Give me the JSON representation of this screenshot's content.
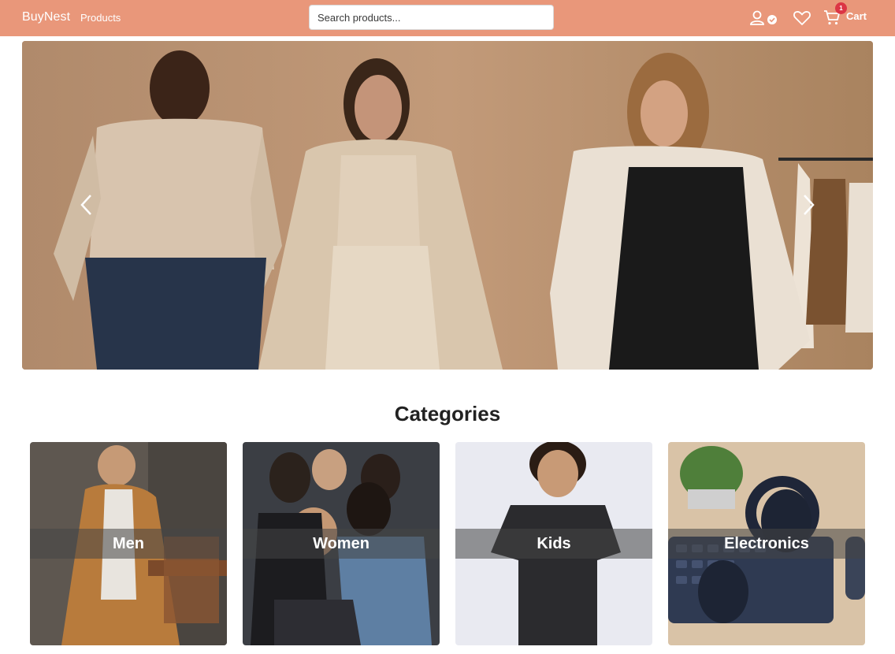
{
  "navbar": {
    "brand": "BuyNest",
    "products_link": "Products",
    "search_placeholder": "Search products...",
    "cart_label": "Cart",
    "cart_count": "1",
    "bg_color": "#E9977A",
    "icons": [
      "user-check-icon",
      "heart-icon",
      "cart-icon"
    ]
  },
  "hero": {
    "slide_subject": "fashion-models",
    "controls": [
      "chevron-left-icon",
      "chevron-right-icon"
    ]
  },
  "categories": {
    "title": "Categories",
    "items": [
      {
        "label": "Men"
      },
      {
        "label": "Women"
      },
      {
        "label": "Kids"
      },
      {
        "label": "Electronics"
      }
    ]
  },
  "colors": {
    "badge": "#DC3545",
    "title_text": "#222222"
  }
}
